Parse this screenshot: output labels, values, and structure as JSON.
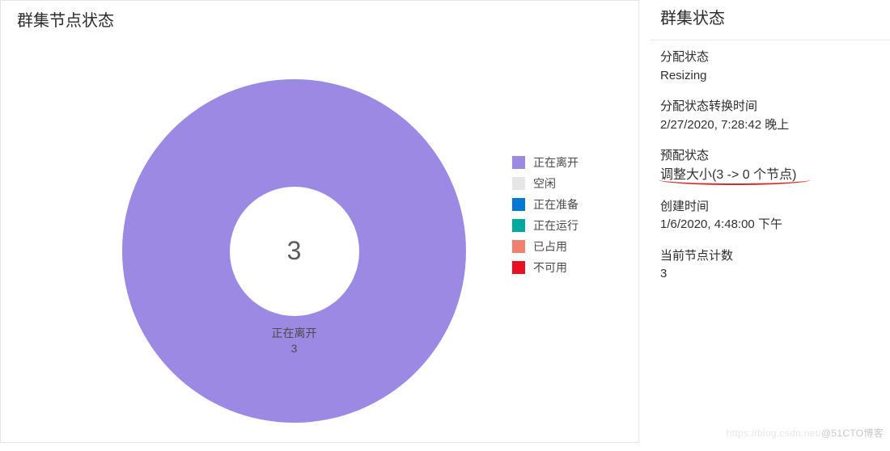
{
  "left": {
    "title": "群集节点状态"
  },
  "chart_data": {
    "type": "pie",
    "title": "群集节点状态",
    "center_value": "3",
    "categories": [
      "正在离开",
      "空闲",
      "正在准备",
      "正在运行",
      "已占用",
      "不可用"
    ],
    "values": [
      3,
      0,
      0,
      0,
      0,
      0
    ],
    "series_colors": [
      "#9b89e4",
      "#e6e6e6",
      "#0078d4",
      "#00a99d",
      "#f08070",
      "#e81123"
    ],
    "segment_label_name": "正在离开",
    "segment_label_value": "3"
  },
  "legend": {
    "items": [
      {
        "label": "正在离开",
        "color": "#9b89e4"
      },
      {
        "label": "空闲",
        "color": "#e6e6e6"
      },
      {
        "label": "正在准备",
        "color": "#0078d4"
      },
      {
        "label": "正在运行",
        "color": "#00a99d"
      },
      {
        "label": "已占用",
        "color": "#f08070"
      },
      {
        "label": "不可用",
        "color": "#e81123"
      }
    ]
  },
  "right": {
    "title": "群集状态",
    "rows": [
      {
        "k": "分配状态",
        "v": "Resizing"
      },
      {
        "k": "分配状态转换时间",
        "v": "2/27/2020, 7:28:42 晚上"
      },
      {
        "k": "预配状态",
        "v": "调整大小(3 -> 0 个节点)",
        "annotated": true
      },
      {
        "k": "创建时间",
        "v": "1/6/2020, 4:48:00 下午"
      },
      {
        "k": "当前节点计数",
        "v": "3"
      }
    ]
  },
  "watermark": {
    "faint": "https://blog.csdn.net/",
    "text": "@51CTO博客"
  }
}
